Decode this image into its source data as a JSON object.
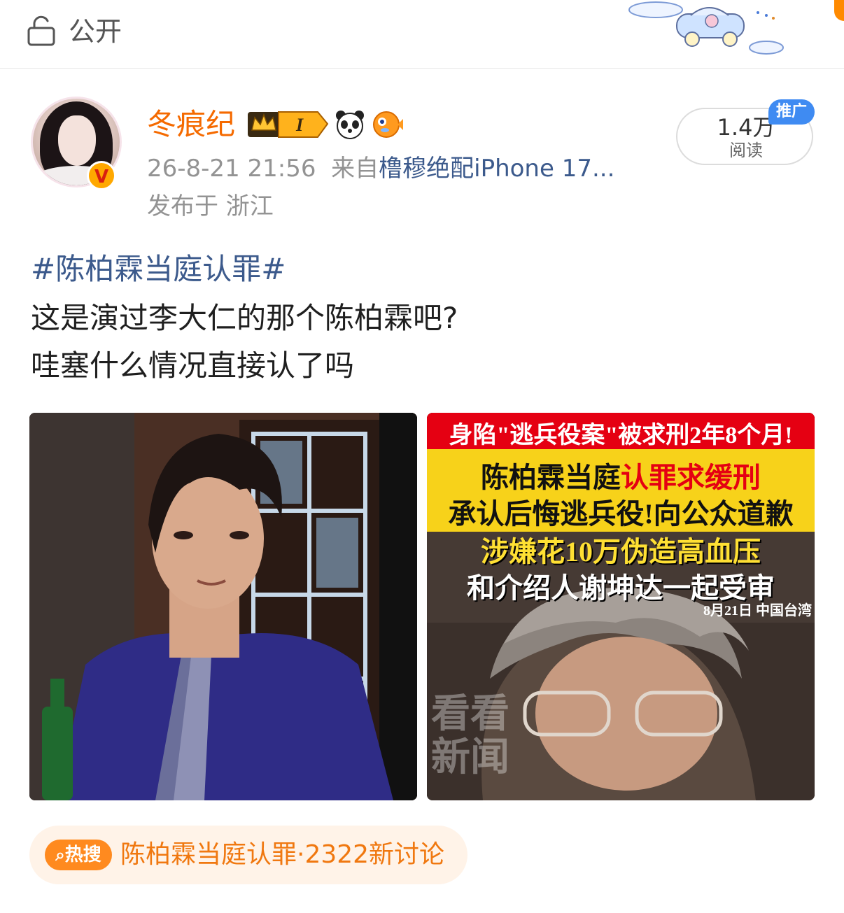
{
  "header": {
    "visibility_label": "公开",
    "lock_icon": "unlock-icon",
    "decoration": "cloud-car-sticker"
  },
  "post": {
    "author": {
      "name": "冬痕纪",
      "avatar": "avatar-portrait",
      "verified_badge_letter": "V",
      "member_badge_letter": "I",
      "badges": [
        "crown-member-icon",
        "panda-icon",
        "pufferfish-icon"
      ]
    },
    "meta": {
      "timestamp": "26-8-21 21:56",
      "source_prefix": "来自",
      "source": "橹穆绝配iPhone 17...",
      "location": "发布于 浙江"
    },
    "stats": {
      "read_count": "1.4万",
      "read_label": "阅读",
      "promo_tag": "推广"
    },
    "hashtag": "#陈柏霖当庭认罪#",
    "body_lines": [
      "这是演过李大仁的那个陈柏霖吧?",
      "哇塞什么情况直接认了吗"
    ],
    "images": {
      "left": {
        "description_icon": "man-in-purple-shirt-photo"
      },
      "right": {
        "banner_top": "身陷\"逃兵役案\"被求刑2年8个月!",
        "line1_black": "陈柏霖当庭",
        "line1_red": "认罪求缓刑",
        "line2": "承认后悔逃兵役!向公众道歉",
        "line3": "涉嫌花10万伪造高血压",
        "line4": "和介绍人谢坤达一起受审",
        "dateline": "8月21日  中国台湾",
        "watermark": "看看新闻"
      }
    },
    "hot_search": {
      "icon_label": "热搜",
      "text": "陈柏霖当庭认罪·2322新讨论"
    }
  },
  "colors": {
    "username": "#f56a00",
    "link": "#3c5a8c",
    "hot": "#f07810",
    "promo": "#3f8bf2"
  }
}
